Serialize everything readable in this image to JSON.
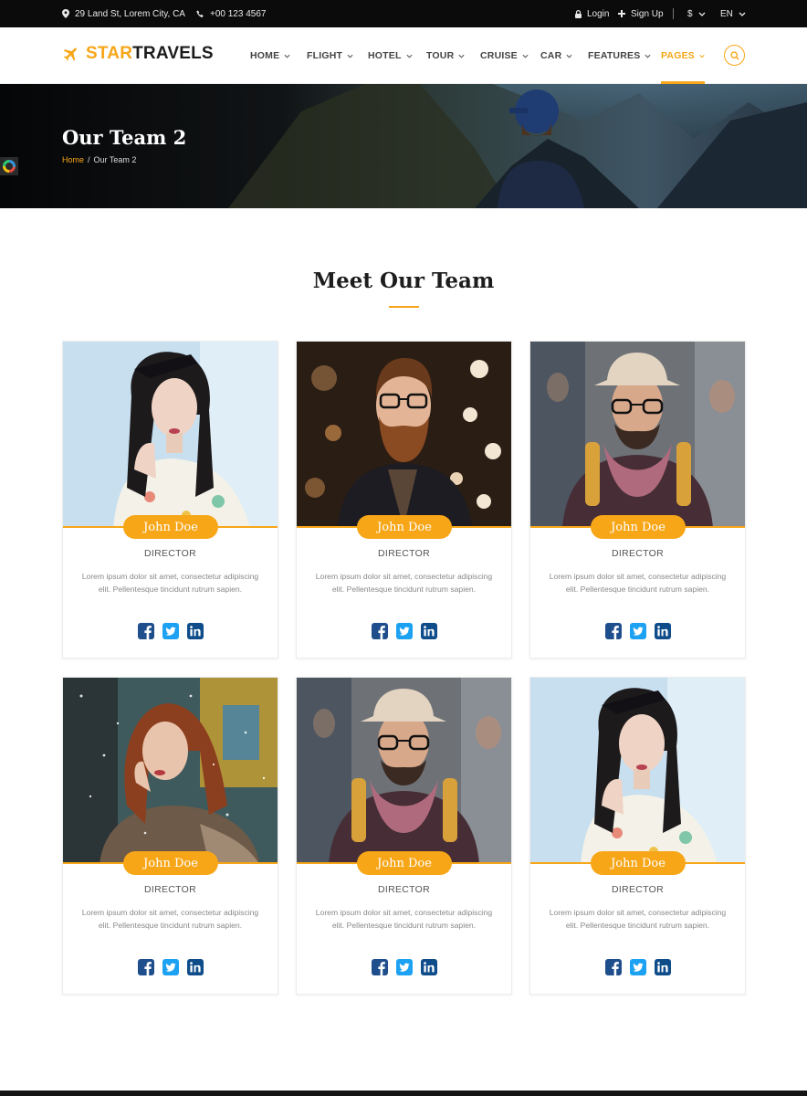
{
  "topbar": {
    "address": "29 Land St, Lorem City, CA",
    "phone": "+00 123 4567",
    "login": "Login",
    "signup": "Sign Up",
    "currency": "$",
    "language": "EN"
  },
  "header": {
    "logo_part1": "STAR",
    "logo_part2": "TRAVELS",
    "nav": [
      "HOME",
      "FLIGHT",
      "HOTEL",
      "TOUR",
      "CRUISE",
      "CAR",
      "FEATURES",
      "PAGES"
    ],
    "active_nav": "PAGES"
  },
  "hero": {
    "title": "Our Team 2",
    "breadcrumb_home": "Home",
    "breadcrumb_sep": "/",
    "breadcrumb_current": "Our Team 2"
  },
  "section": {
    "title": "Meet Our Team"
  },
  "team": [
    {
      "name": "John Doe",
      "role": "DIRECTOR",
      "desc": "Lorem ipsum dolor sit amet, consectetur adipiscing elit. Pellentesque tincidunt rutrum sapien."
    },
    {
      "name": "John Doe",
      "role": "DIRECTOR",
      "desc": "Lorem ipsum dolor sit amet, consectetur adipiscing elit. Pellentesque tincidunt rutrum sapien."
    },
    {
      "name": "John Doe",
      "role": "DIRECTOR",
      "desc": "Lorem ipsum dolor sit amet, consectetur adipiscing elit. Pellentesque tincidunt rutrum sapien."
    },
    {
      "name": "John Doe",
      "role": "DIRECTOR",
      "desc": "Lorem ipsum dolor sit amet, consectetur adipiscing elit. Pellentesque tincidunt rutrum sapien."
    },
    {
      "name": "John Doe",
      "role": "DIRECTOR",
      "desc": "Lorem ipsum dolor sit amet, consectetur adipiscing elit. Pellentesque tincidunt rutrum sapien."
    },
    {
      "name": "John Doe",
      "role": "DIRECTOR",
      "desc": "Lorem ipsum dolor sit amet, consectetur adipiscing elit. Pellentesque tincidunt rutrum sapien."
    }
  ],
  "social_icons": [
    "facebook-icon",
    "twitter-icon",
    "linkedin-icon"
  ],
  "colors": {
    "accent": "#f7a618",
    "topbar": "#0b0b0b",
    "facebook": "#1f4e8c",
    "twitter": "#1da1f2",
    "linkedin": "#0e4c8a"
  }
}
